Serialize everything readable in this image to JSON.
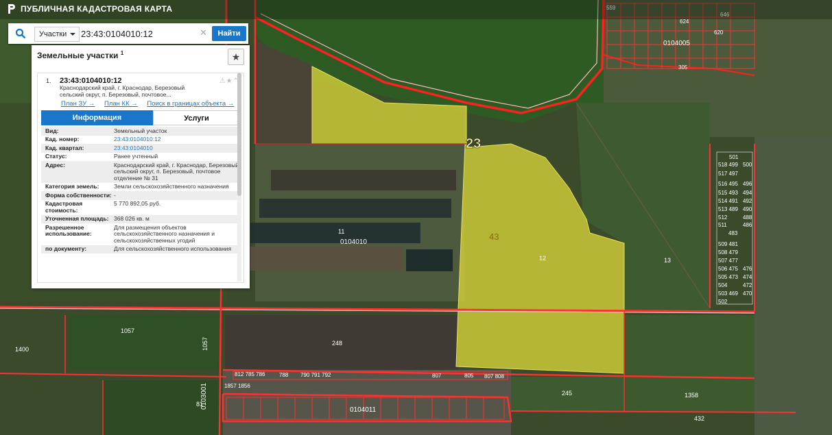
{
  "app": {
    "title": "ПУБЛИЧНАЯ КАДАСТРОВАЯ КАРТА"
  },
  "search": {
    "type_selected": "Участки",
    "query": "23:43:0104010:12",
    "button": "Найти"
  },
  "panel": {
    "title": "Земельные участки",
    "count_sup": "1",
    "result": {
      "index": "1.",
      "cadastral_number": "23:43:0104010:12",
      "address_preview": "Краснодарский край, г. Краснодар, Березовый сельский округ, п. Березовый, почтовое...",
      "links": [
        "План ЗУ →",
        "План КК →",
        "Поиск в границах объекта →"
      ],
      "tabs": {
        "info": "Информация",
        "services": "Услуги"
      },
      "fields": [
        {
          "k": "Вид:",
          "v": "Земельный участок"
        },
        {
          "k": "Кад. номер:",
          "v": "23:43:0104010:12"
        },
        {
          "k": "Кад. квартал:",
          "v": "23:43:0104010"
        },
        {
          "k": "Статус:",
          "v": "Ранее учтенный"
        },
        {
          "k": "Адрес:",
          "v": "Краснодарский край, г. Краснодар, Березовый сельский округ, п. Березовый, почтовое отделение № 31"
        },
        {
          "k": "Категория земель:",
          "v": "Земли сельскохозяйственного назначения"
        },
        {
          "k": "Форма собственности:",
          "v": "-"
        },
        {
          "k": "Кадастровая стоимость:",
          "v": "5 770 892,05 руб."
        },
        {
          "k": "Уточненная площадь:",
          "v": "368 026 кв. м"
        },
        {
          "k": "Разрешенное использование:",
          "v": "Для размещения объектов сельскохозяйственного назначения и сельскохозяйственных угодий"
        },
        {
          "k": "по документу:",
          "v": "Для сельскохозяйственного использования"
        }
      ]
    }
  },
  "map": {
    "labels": {
      "l23": "23",
      "l43": "43",
      "l12": "12",
      "l11": "11",
      "l13": "13",
      "q0104010": "0104010",
      "q0104005": "0104005",
      "q0104011": "0104011",
      "q0103001": "0103001",
      "l248": "248",
      "l1057a": "1057",
      "l1057b": "1057",
      "l1400": "1400",
      "l245": "245",
      "l1358": "1358",
      "l432": "432",
      "l81": "81",
      "l559": "559",
      "l624": "624",
      "l646": "646",
      "l620": "620",
      "l305": "305",
      "l501": "501",
      "l500": "500",
      "l483": "483",
      "l502": "502",
      "l788": "788",
      "l807": "807",
      "l805": "805",
      "l807808": "807 808",
      "l812785786": "812 785 786",
      "l790791792": "790 791 792",
      "l18571856": "1857 1856",
      "lr518499": "518 499",
      "lr517497": "517 497",
      "lr516495": "516 495",
      "lr515493": "515 493",
      "lr514491": "514 491",
      "lr513489": "513 489",
      "lr512": "512",
      "lr511": "511",
      "lr509481": "509 481",
      "lr508479": "508 479",
      "lr507477": "507 477",
      "lr506475": "506 475",
      "lr505473": "505 473",
      "lr504": "504",
      "lr503469": "503 469",
      "rr496": "496",
      "rr494": "494",
      "rr492": "492",
      "rr490": "490",
      "rr488": "488",
      "rr486": "486",
      "rr476": "476",
      "rr474": "474",
      "rr472": "472",
      "rr470": "470"
    }
  }
}
